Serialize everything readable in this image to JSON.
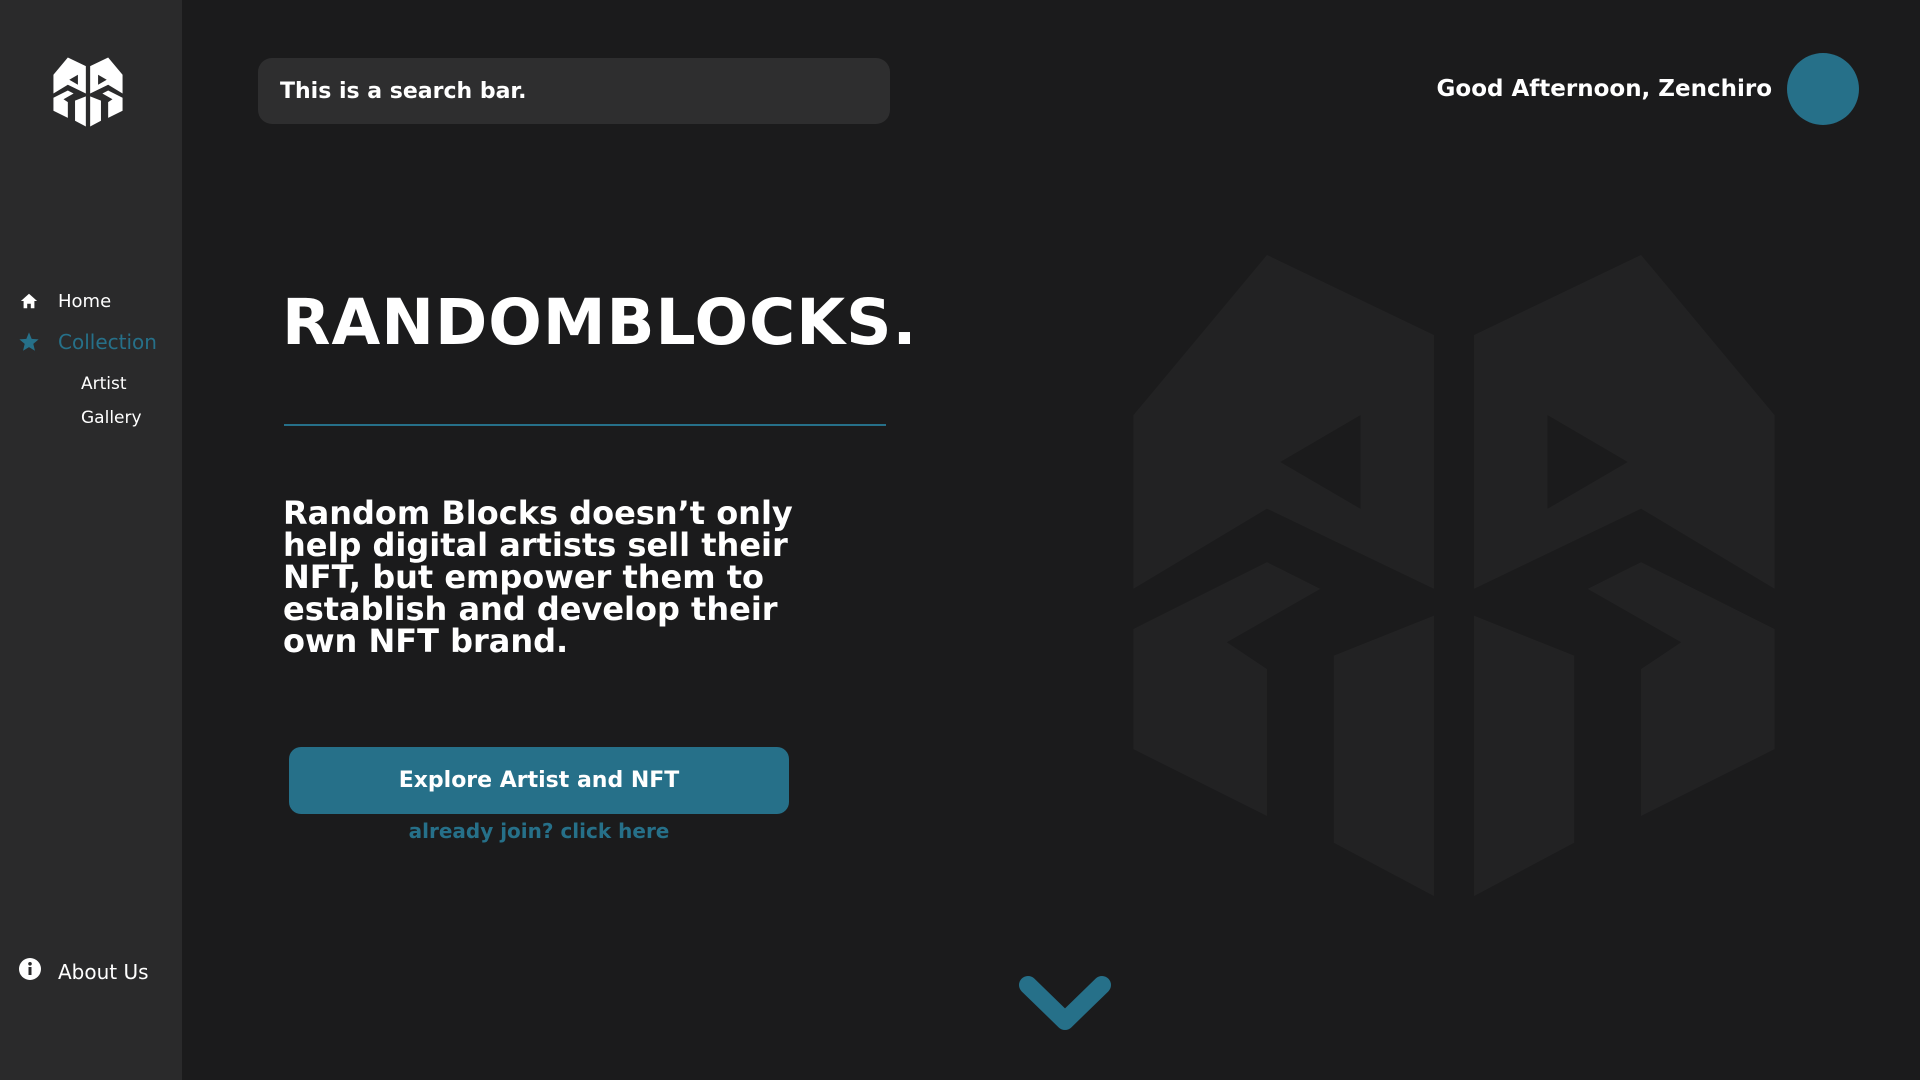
{
  "colors": {
    "background": "#1b1b1c",
    "sidebar": "#2a2a2b",
    "accent": "#267089",
    "text": "#ffffff"
  },
  "sidebar": {
    "logo_icon": "randomblocks-logo-icon",
    "nav": [
      {
        "label": "Home",
        "icon": "home-icon",
        "active": false
      },
      {
        "label": "Collection",
        "icon": "star-icon",
        "active": true,
        "children": [
          {
            "label": "Artist"
          },
          {
            "label": "Gallery"
          }
        ]
      }
    ],
    "footer": {
      "label": "About Us",
      "icon": "info-icon"
    }
  },
  "header": {
    "search": {
      "placeholder": "This is a search bar."
    },
    "greeting": "Good Afternoon, Zenchiro",
    "avatar_icon": "avatar"
  },
  "hero": {
    "title": "RANDOMBLOCKS.",
    "description": "Random Blocks doesn’t only help digital artists sell their NFT, but empower them to establish and develop their own NFT brand.",
    "cta_label": "Explore Artist and NFT",
    "join_link": "already join? click here",
    "scroll_icon": "chevron-down-icon"
  }
}
